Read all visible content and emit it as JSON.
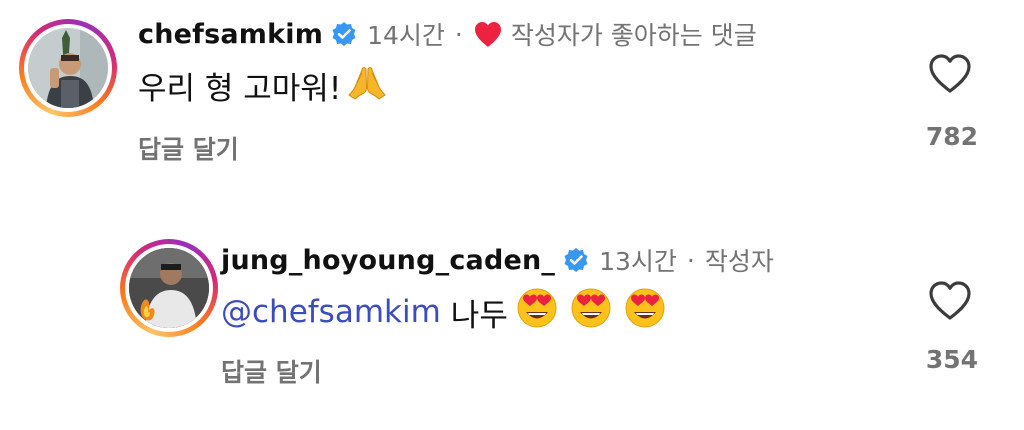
{
  "comments": [
    {
      "username": "chefsamkim",
      "time": "14시간",
      "creator_badge": "작성자가 좋아하는 댓글",
      "text": "우리 형 고마워!",
      "emojis": [
        "folded-hands"
      ],
      "reply_label": "답글 달기",
      "like_count": "782"
    },
    {
      "username": "jung_hoyoung_caden_",
      "time": "13시간",
      "creator_badge": "작성자",
      "mention": "@chefsamkim",
      "text": "나두",
      "emojis": [
        "heart-eyes",
        "heart-eyes",
        "heart-eyes"
      ],
      "reply_label": "답글 달기",
      "like_count": "354"
    }
  ],
  "colors": {
    "verified": "#3897f0",
    "heart": "#ed2140",
    "meta": "#737373",
    "mention": "#3b4cc0"
  }
}
